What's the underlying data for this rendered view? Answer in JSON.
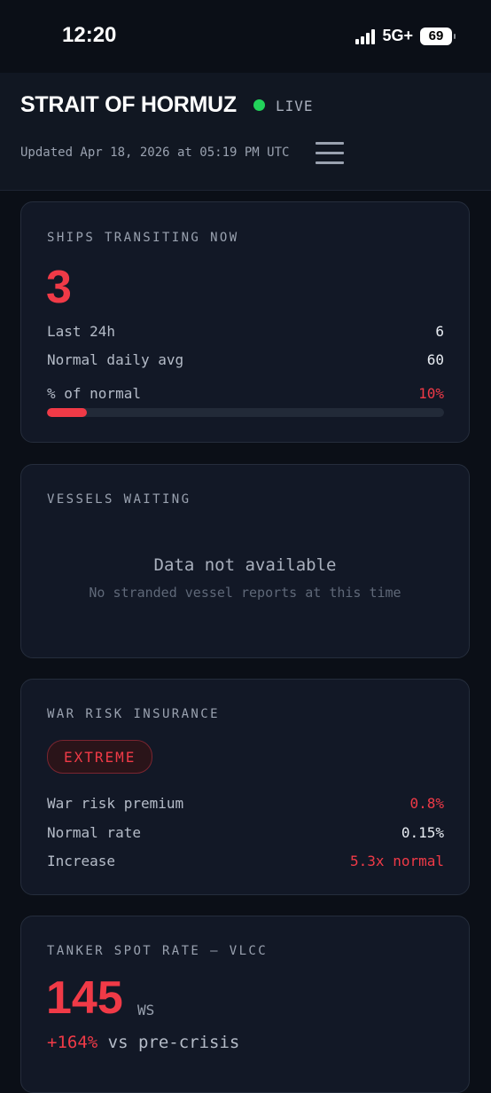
{
  "status_bar": {
    "time": "12:20",
    "network": "5G+",
    "battery": "69"
  },
  "header": {
    "title": "STRAIT OF HORMUZ",
    "live_label": "LIVE",
    "updated": "Updated Apr 18, 2026 at 05:19 PM UTC"
  },
  "ships": {
    "label": "SHIPS TRANSITING NOW",
    "value": "3",
    "rows": [
      {
        "k": "Last 24h",
        "v": "6"
      },
      {
        "k": "Normal daily avg",
        "v": "60"
      },
      {
        "k": "% of normal",
        "v": "10%"
      }
    ],
    "progress_fraction": 0.1
  },
  "vessels": {
    "label": "VESSELS WAITING",
    "na_title": "Data not available",
    "na_sub": "No stranded vessel reports at this time"
  },
  "insurance": {
    "label": "WAR RISK INSURANCE",
    "badge": "EXTREME",
    "rows": [
      {
        "k": "War risk premium",
        "v": "0.8%"
      },
      {
        "k": "Normal rate",
        "v": "0.15%"
      },
      {
        "k": "Increase",
        "v": "5.3x normal"
      }
    ]
  },
  "tanker": {
    "label": "TANKER SPOT RATE — VLCC",
    "value": "145",
    "unit": "WS",
    "change": "+164%",
    "change_suffix": "vs pre-crisis"
  },
  "colors": {
    "accent_red": "#f03a47",
    "live_green": "#22d35a",
    "background": "#0b0f17"
  },
  "icons": {
    "menu": "hamburger-menu-icon",
    "live": "live-status-dot-icon"
  }
}
